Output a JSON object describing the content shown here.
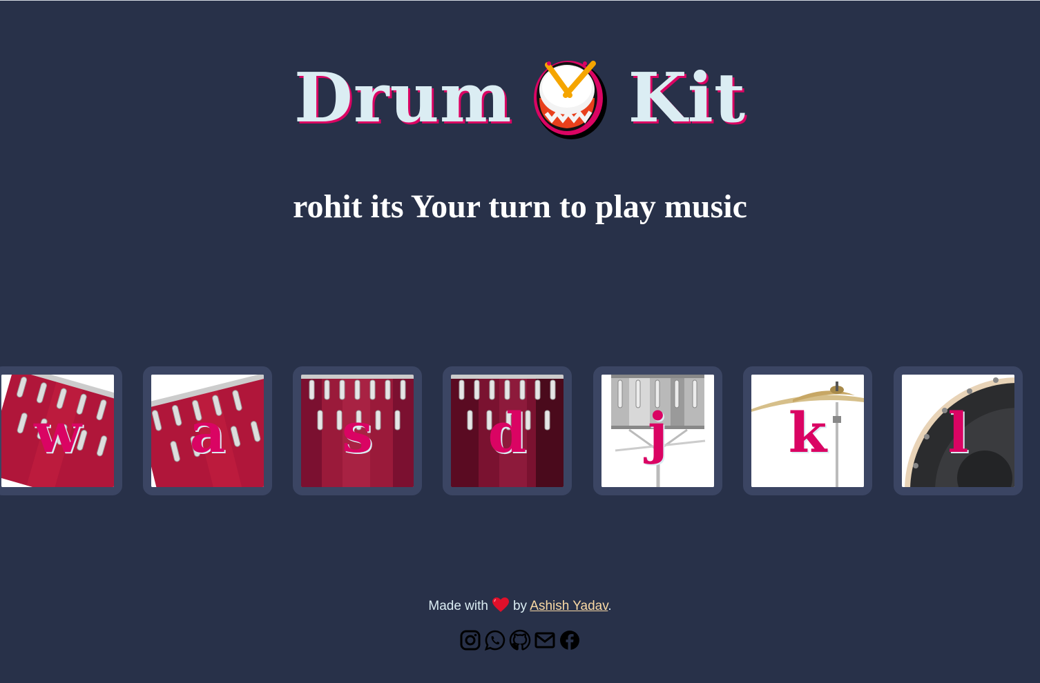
{
  "header": {
    "title_left": "Drum",
    "title_right": "Kit",
    "title_icon": "drum-icon"
  },
  "greeting": "rohit its Your turn to play music",
  "drums": [
    {
      "key": "w",
      "image": "tom-drum-tilted"
    },
    {
      "key": "a",
      "image": "tom-drum-tilted"
    },
    {
      "key": "s",
      "image": "snare-drum"
    },
    {
      "key": "d",
      "image": "snare-drum-dark"
    },
    {
      "key": "j",
      "image": "silver-snare-stand"
    },
    {
      "key": "k",
      "image": "cymbal"
    },
    {
      "key": "l",
      "image": "kick-drum"
    }
  ],
  "footer": {
    "made_with": "Made with",
    "by": "by",
    "author": "Ashish Yadav",
    "period": ".",
    "heart_icon": "heart-icon"
  },
  "socials": [
    "instagram-icon",
    "whatsapp-icon",
    "github-icon",
    "mail-icon",
    "facebook-icon"
  ],
  "colors": {
    "background": "#283149",
    "title": "#dbedf3",
    "accent": "#da0463",
    "tile_border": "#3b4563",
    "link": "#fbdaa5"
  }
}
